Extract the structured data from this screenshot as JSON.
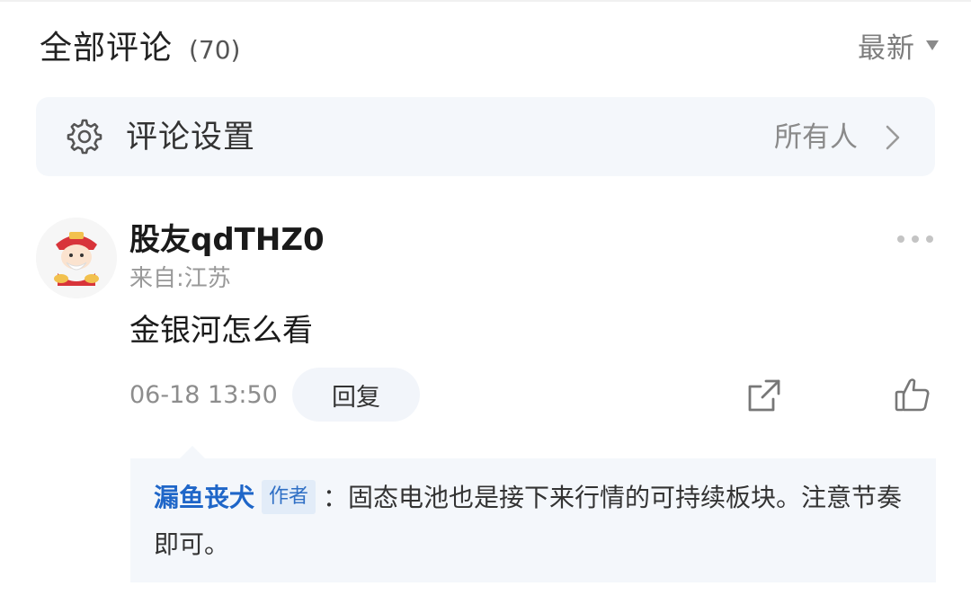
{
  "header": {
    "title": "全部评论",
    "count": "(70)",
    "sort_label": "最新"
  },
  "settings": {
    "label": "评论设置",
    "value": "所有人"
  },
  "comment": {
    "username": "股友qdTHZ0",
    "location": "来自:江苏",
    "text": "金银河怎么看",
    "timestamp": "06-18 13:50",
    "reply_label": "回复"
  },
  "reply": {
    "author": "漏鱼丧犬",
    "badge": "作者",
    "text": "：固态电池也是接下来行情的可持续板块。注意节奏即可。"
  },
  "icons": {
    "gear": "gear-icon",
    "chevron": "chevron-right-icon",
    "more": "more-horizontal-icon",
    "share": "share-icon",
    "like": "thumbs-up-icon",
    "avatar": "fortune-god-avatar"
  },
  "colors": {
    "accent": "#1f66c8",
    "panel_bg": "#f4f7fb",
    "muted_text": "#999999"
  }
}
